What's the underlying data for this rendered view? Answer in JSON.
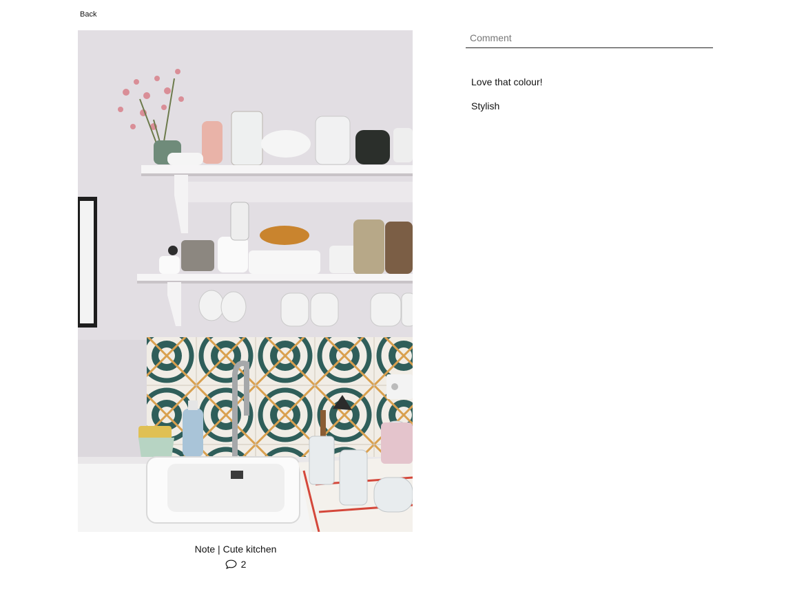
{
  "nav": {
    "back_label": "Back"
  },
  "photo": {
    "subject": "kitchen shelves with dishes above a tiled sink",
    "wall_color": "#dcd8dd",
    "tile_colors": [
      "#2f5e5a",
      "#d9a04f",
      "#f1ede6"
    ]
  },
  "post": {
    "caption": "Note | Cute kitchen",
    "comment_count": "2",
    "comment_icon": "speech-bubble-icon"
  },
  "comment_form": {
    "placeholder": "Comment",
    "value": ""
  },
  "comments": [
    {
      "text": "Love that colour!"
    },
    {
      "text": "Stylish"
    }
  ]
}
